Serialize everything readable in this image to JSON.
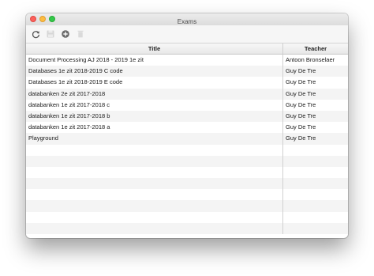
{
  "window": {
    "title": "Exams"
  },
  "toolbar": {
    "buttons": [
      {
        "icon": "refresh-icon",
        "enabled": true
      },
      {
        "icon": "save-icon",
        "enabled": false
      },
      {
        "icon": "add-icon",
        "enabled": true
      },
      {
        "icon": "delete-icon",
        "enabled": false
      }
    ]
  },
  "table": {
    "columns": [
      "Title",
      "Teacher"
    ],
    "rows": [
      {
        "title": "Document Processing AJ 2018 - 2019 1e zit",
        "teacher": "Antoon Bronselaer"
      },
      {
        "title": "Databases 1e zit 2018-2019 C code",
        "teacher": "Guy De Tre"
      },
      {
        "title": "Databases 1e zit 2018-2019 E code",
        "teacher": "Guy De Tre"
      },
      {
        "title": "databanken 2e zit 2017-2018",
        "teacher": "Guy De Tre"
      },
      {
        "title": "databanken 1e zit 2017-2018 c",
        "teacher": "Guy De Tre"
      },
      {
        "title": "databanken 1e zit 2017-2018 b",
        "teacher": "Guy De Tre"
      },
      {
        "title": "databanken 1e zit 2017-2018 a",
        "teacher": "Guy De Tre"
      },
      {
        "title": "Playground",
        "teacher": "Guy De Tre"
      },
      {
        "title": "",
        "teacher": ""
      },
      {
        "title": "",
        "teacher": ""
      },
      {
        "title": "",
        "teacher": ""
      },
      {
        "title": "",
        "teacher": ""
      },
      {
        "title": "",
        "teacher": ""
      },
      {
        "title": "",
        "teacher": ""
      },
      {
        "title": "",
        "teacher": ""
      },
      {
        "title": "",
        "teacher": ""
      }
    ]
  },
  "colors": {
    "close": "#fc605b",
    "minimize": "#fdbc40",
    "maximize": "#34c84a",
    "row_alt": "#f4f4f4"
  }
}
